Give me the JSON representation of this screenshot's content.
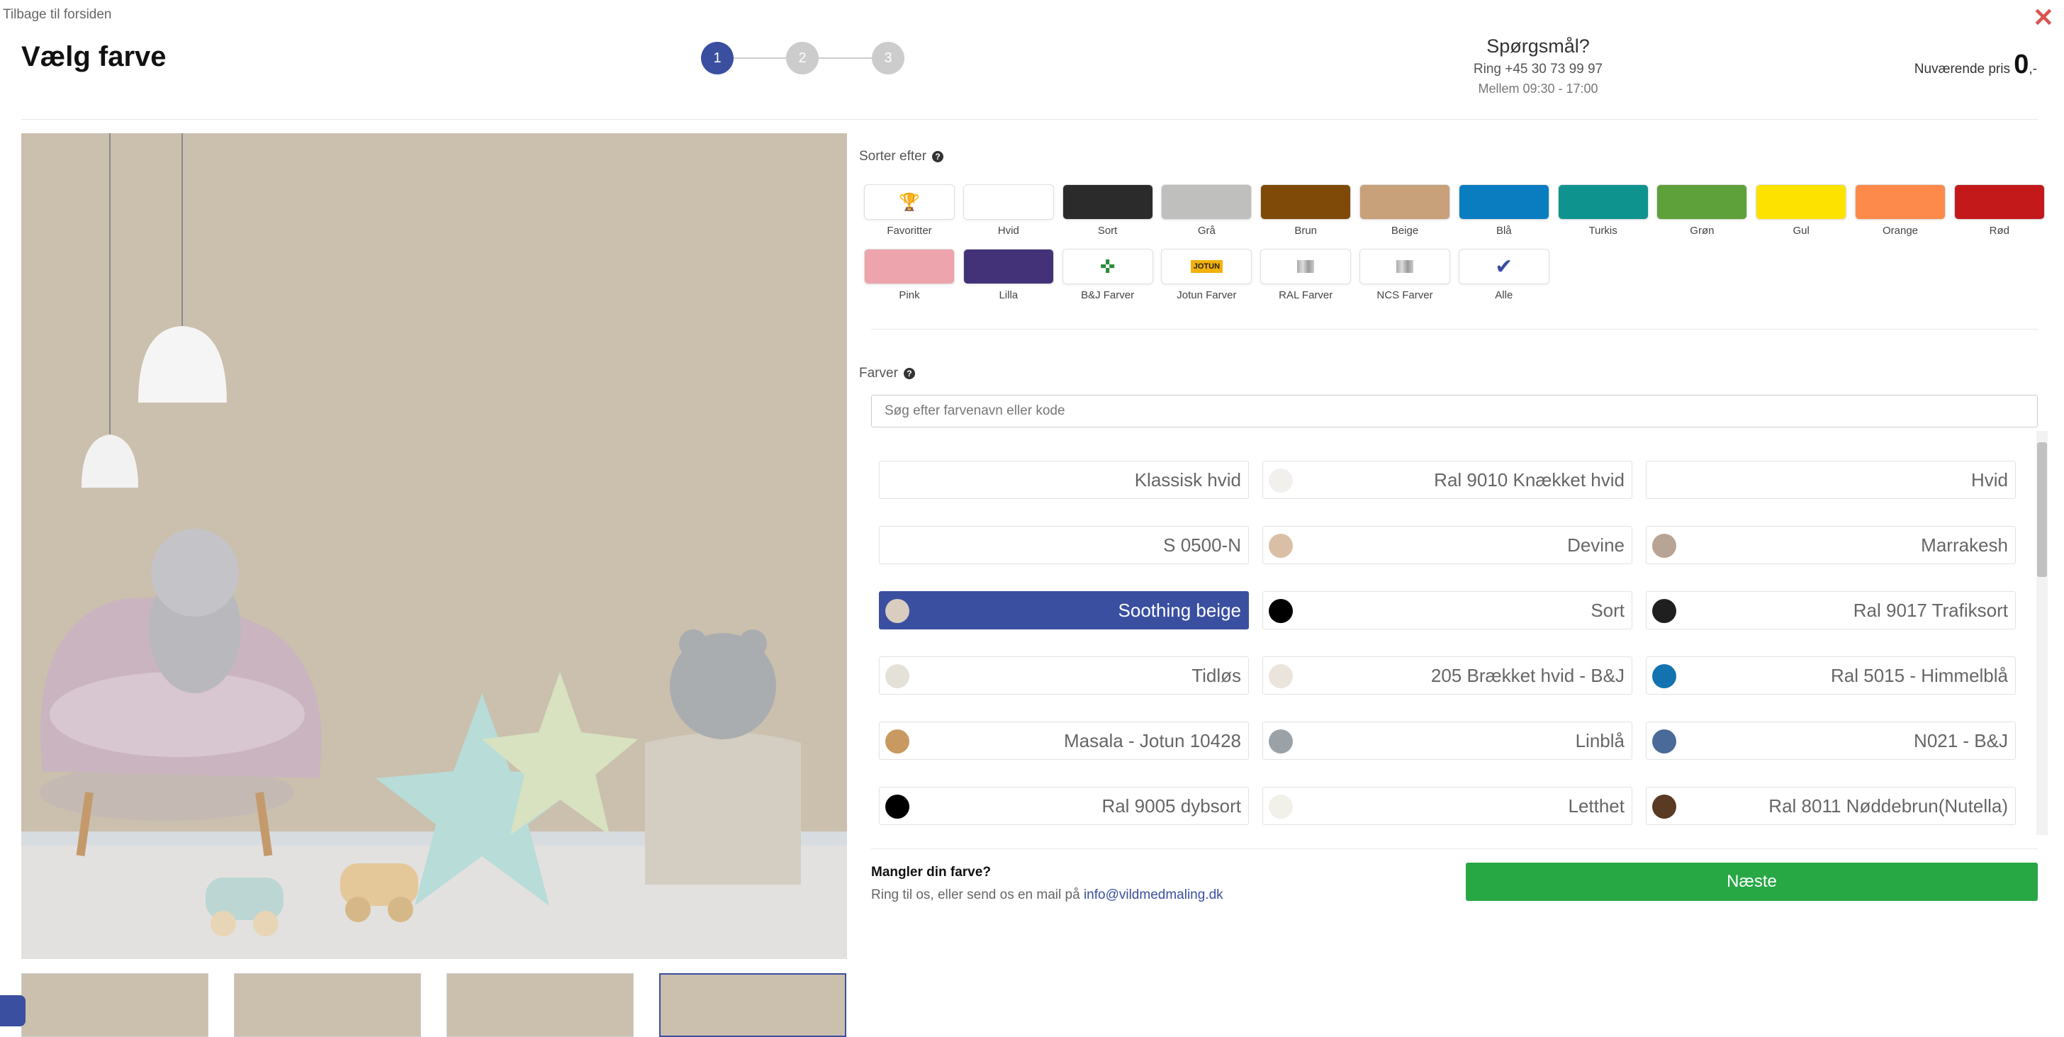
{
  "header": {
    "back_link": "Tilbage til forsiden",
    "title": "Vælg farve",
    "steps": [
      "1",
      "2",
      "3"
    ],
    "questions_title": "Spørgsmål?",
    "questions_phone": "Ring +45 30 73 99 97",
    "questions_hours": "Mellem 09:30 - 17:00",
    "price_label": "Nuværende pris",
    "price_value": "0",
    "price_suffix": ",-"
  },
  "sort": {
    "label": "Sorter efter",
    "filters": [
      {
        "label": "Favoritter",
        "color": "#ffffff",
        "icon": "trophy-icon"
      },
      {
        "label": "Hvid",
        "color": "#ffffff"
      },
      {
        "label": "Sort",
        "color": "#2b2b2b"
      },
      {
        "label": "Grå",
        "color": "#bfbfbd"
      },
      {
        "label": "Brun",
        "color": "#7f4a07"
      },
      {
        "label": "Beige",
        "color": "#c8a07a"
      },
      {
        "label": "Blå",
        "color": "#0a7dc1"
      },
      {
        "label": "Turkis",
        "color": "#0f938f"
      },
      {
        "label": "Grøn",
        "color": "#5ea03a"
      },
      {
        "label": "Gul",
        "color": "#fde200"
      },
      {
        "label": "Orange",
        "color": "#fd8a4a"
      },
      {
        "label": "Rød",
        "color": "#c3191a"
      },
      {
        "label": "Pink",
        "color": "#eea4ad"
      },
      {
        "label": "Lilla",
        "color": "#433278"
      },
      {
        "label": "B&J Farver",
        "color": "#ffffff",
        "icon": "bj-logo-icon"
      },
      {
        "label": "Jotun Farver",
        "color": "#ffffff",
        "icon": "jotun-logo-icon",
        "logo_text": "JOTUN"
      },
      {
        "label": "RAL Farver",
        "color": "#ffffff",
        "icon": "ral-swatch-icon"
      },
      {
        "label": "NCS Farver",
        "color": "#ffffff",
        "icon": "ncs-swatch-icon"
      },
      {
        "label": "Alle",
        "color": "#ffffff",
        "icon": "checkmark-icon"
      }
    ]
  },
  "colors": {
    "label": "Farver",
    "search_placeholder": "Søg efter farvenavn eller kode",
    "items": [
      {
        "name": "Klassisk hvid",
        "dot": "#ffffff"
      },
      {
        "name": "Ral 9010 Knækket hvid",
        "dot": "#f1f0ec"
      },
      {
        "name": "Hvid",
        "dot": "#ffffff"
      },
      {
        "name": "S 0500-N",
        "dot": "#ffffff"
      },
      {
        "name": "Devine",
        "dot": "#d9bfa5"
      },
      {
        "name": "Marrakesh",
        "dot": "#b8a494"
      },
      {
        "name": "Soothing beige",
        "dot": "#d9cdc0",
        "selected": true
      },
      {
        "name": "Sort",
        "dot": "#000000"
      },
      {
        "name": "Ral 9017 Trafiksort",
        "dot": "#1f1f1f"
      },
      {
        "name": "Tidløs",
        "dot": "#e4e2d8"
      },
      {
        "name": "205 Brækket hvid - B&J",
        "dot": "#ebe4dc"
      },
      {
        "name": "Ral 5015 - Himmelblå",
        "dot": "#1273b0"
      },
      {
        "name": "Masala - Jotun 10428",
        "dot": "#c89a62"
      },
      {
        "name": "Linblå",
        "dot": "#9aa2a7"
      },
      {
        "name": "N021 - B&J",
        "dot": "#4a6b99"
      },
      {
        "name": "Ral 9005 dybsort",
        "dot": "#000000"
      },
      {
        "name": "Letthet",
        "dot": "#f1f1ea"
      },
      {
        "name": "Ral 8011 Nøddebrun(Nutella)",
        "dot": "#5a3a22"
      }
    ]
  },
  "footer": {
    "missing_title": "Mangler din farve?",
    "missing_text": "Ring til os, eller send os en mail på",
    "email": "info@vildmedmaling.dk",
    "next_button": "Næste"
  },
  "theme": {
    "accent": "#3b4fa0",
    "success": "#28a745",
    "close": "#d9534f"
  }
}
